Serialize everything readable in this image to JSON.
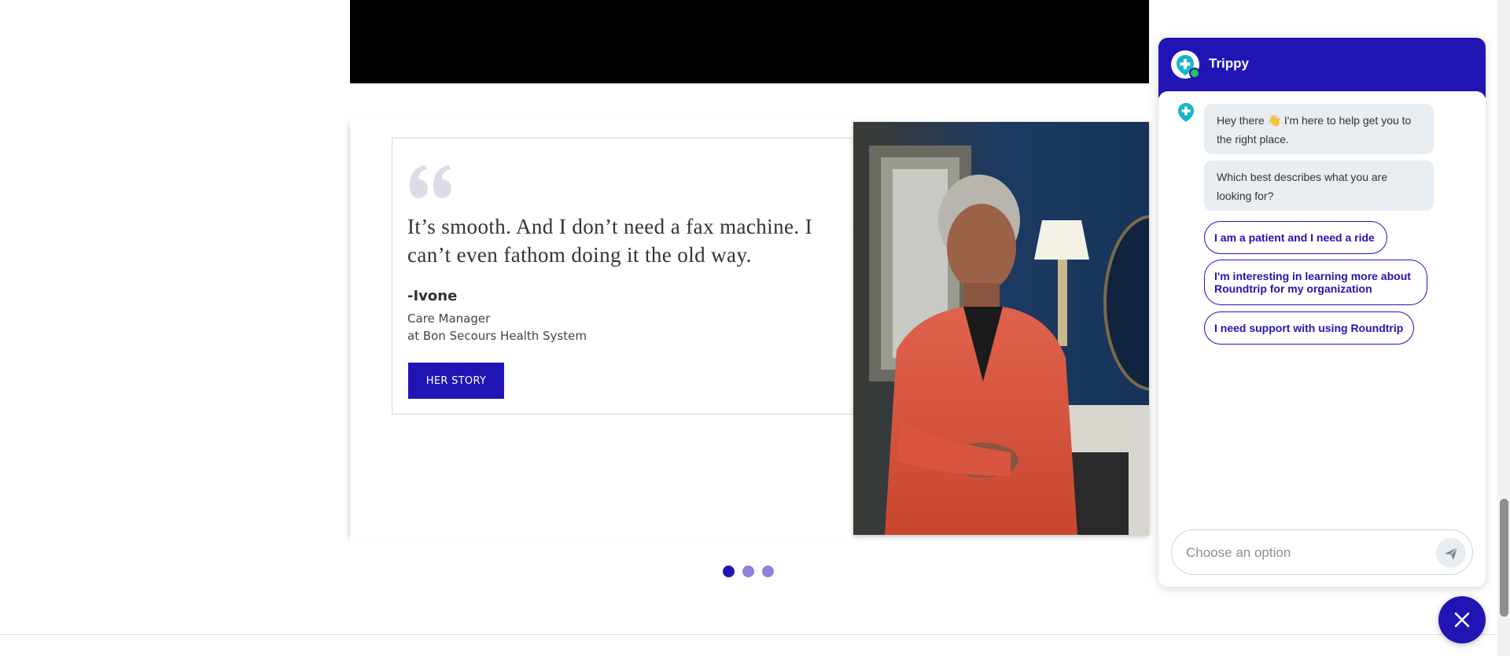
{
  "testimonial": {
    "quote": "It’s smooth. And I don’t need a fax machine. I can’t even fathom doing it the old way.",
    "author": "-Ivone",
    "role_line1": "Care Manager",
    "role_line2": "at Bon Secours Health System",
    "button_label": "HER STORY"
  },
  "carousel": {
    "dot_count": 3,
    "active_index": 0
  },
  "chat": {
    "title": "Trippy",
    "messages": [
      "Hey there 👋 I'm here to help get you to the right place.",
      "Which best describes what you are looking for?"
    ],
    "options": [
      "I am a patient and I need a ride",
      "I'm interesting in learning more about Roundtrip for my organization",
      "I need support with using Roundtrip"
    ],
    "input_placeholder": "Choose an option"
  },
  "colors": {
    "brand": "#2114b5",
    "brand_light": "#8a83d9",
    "teal": "#19b5c8",
    "bubble_bg": "#e8edf2"
  },
  "icons": {
    "quote": "quote-mark-icon",
    "bot": "trippy-logo-icon",
    "send": "send-icon",
    "close": "close-icon"
  }
}
